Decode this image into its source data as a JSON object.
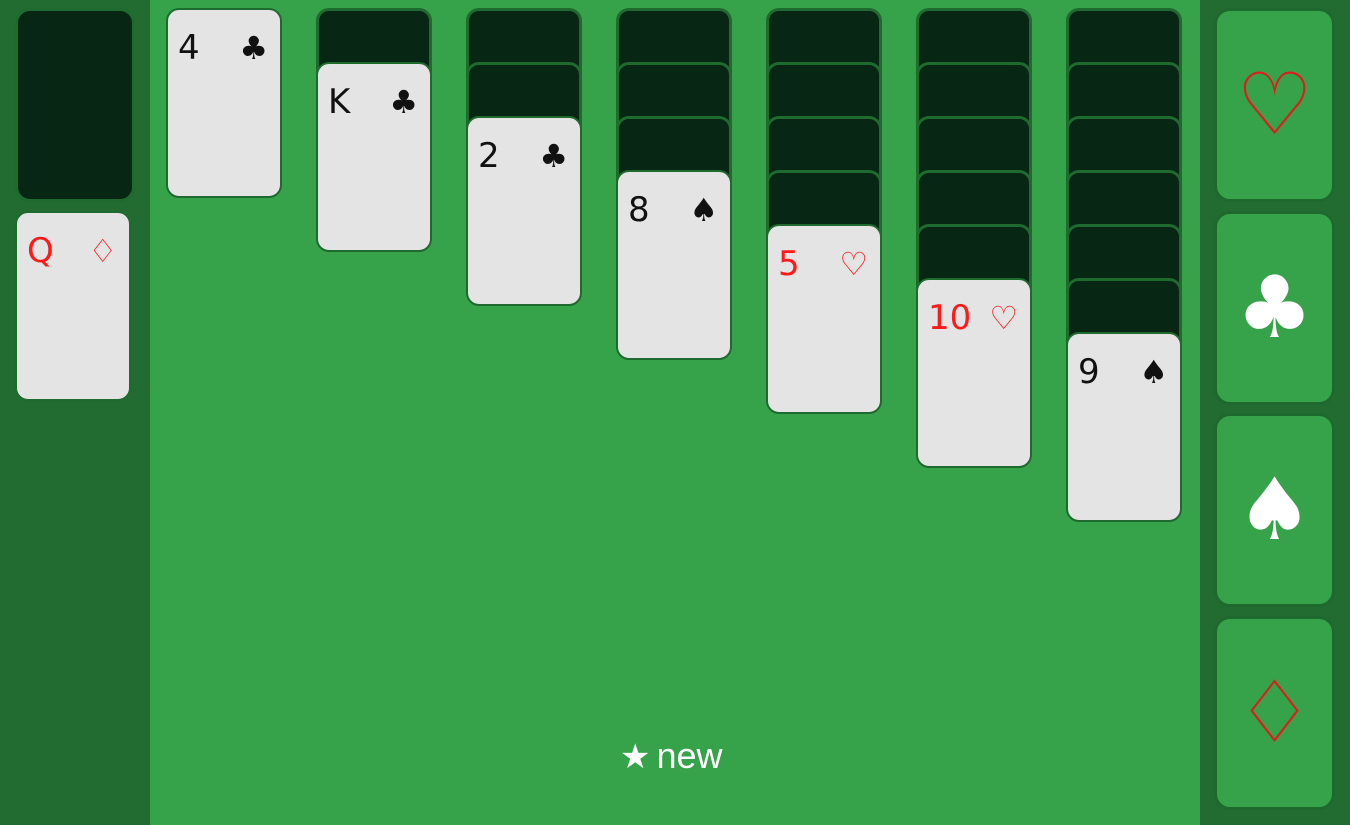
{
  "colors": {
    "felt": "#36a249",
    "side_panel": "#226c31",
    "card_back": "#072614",
    "card_face": "#e4e4e4",
    "red_suit": "#ff1a1a",
    "black_suit": "#111111"
  },
  "stock": {
    "face_down": true
  },
  "waste": {
    "rank": "Q",
    "suit": "♢",
    "color": "red"
  },
  "tableau": [
    {
      "hidden": 0,
      "rank": "4",
      "suit": "♣",
      "color": "black"
    },
    {
      "hidden": 1,
      "rank": "K",
      "suit": "♣",
      "color": "black"
    },
    {
      "hidden": 2,
      "rank": "2",
      "suit": "♣",
      "color": "black"
    },
    {
      "hidden": 3,
      "rank": "8",
      "suit": "♠",
      "color": "black"
    },
    {
      "hidden": 4,
      "rank": "5",
      "suit": "♡",
      "color": "red"
    },
    {
      "hidden": 5,
      "rank": "10",
      "suit": "♡",
      "color": "red"
    },
    {
      "hidden": 6,
      "rank": "9",
      "suit": "♠",
      "color": "black"
    }
  ],
  "foundations": [
    {
      "name": "hearts",
      "symbol": "♡",
      "color": "red"
    },
    {
      "name": "clubs",
      "symbol": "♣",
      "color": "white"
    },
    {
      "name": "spades",
      "symbol": "♠",
      "color": "white"
    },
    {
      "name": "diamonds",
      "symbol": "♢",
      "color": "red"
    }
  ],
  "new_button": {
    "icon": "star-icon",
    "star": "★",
    "label": "new"
  }
}
